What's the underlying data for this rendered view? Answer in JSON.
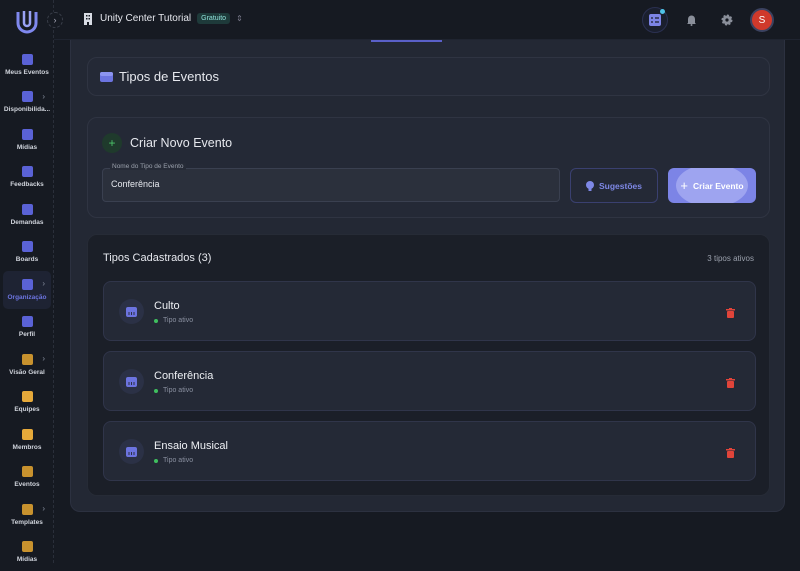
{
  "header": {
    "org_name": "Unity Center Tutorial",
    "plan_badge": "Gratuito",
    "avatar_initial": "S"
  },
  "sidebar": {
    "items": [
      {
        "label": "Meus Eventos",
        "color": "#5a62d6",
        "chevron": false,
        "active": false
      },
      {
        "label": "Disponibilida...",
        "color": "#5a62d6",
        "chevron": true,
        "active": false
      },
      {
        "label": "Mídias",
        "color": "#5a62d6",
        "chevron": false,
        "active": false
      },
      {
        "label": "Feedbacks",
        "color": "#5a62d6",
        "chevron": false,
        "active": false
      },
      {
        "label": "Demandas",
        "color": "#5a62d6",
        "chevron": false,
        "active": false
      },
      {
        "label": "Boards",
        "color": "#5a62d6",
        "chevron": false,
        "active": false
      },
      {
        "label": "Organização",
        "color": "#5a62d6",
        "chevron": true,
        "active": true
      },
      {
        "label": "Perfil",
        "color": "#5a62d6",
        "chevron": false,
        "active": false
      },
      {
        "label": "Visão Geral",
        "color": "#c8922e",
        "chevron": true,
        "active": false
      },
      {
        "label": "Equipes",
        "color": "#e6a93a",
        "chevron": false,
        "active": false
      },
      {
        "label": "Membros",
        "color": "#e6a93a",
        "chevron": false,
        "active": false
      },
      {
        "label": "Eventos",
        "color": "#c8922e",
        "chevron": false,
        "active": false
      },
      {
        "label": "Templates",
        "color": "#c8922e",
        "chevron": true,
        "active": false
      },
      {
        "label": "Mídias",
        "color": "#c8922e",
        "chevron": false,
        "active": false
      }
    ]
  },
  "page": {
    "title": "Tipos de Eventos"
  },
  "create": {
    "title": "Criar Novo Evento",
    "field_label": "Nome do Tipo de Evento",
    "field_value": "Conferência",
    "suggestions_label": "Sugestões",
    "create_label": "Criar Evento"
  },
  "list": {
    "title": "Tipos Cadastrados (3)",
    "count_text": "3 tipos ativos",
    "items": [
      {
        "name": "Culto",
        "status": "Tipo ativo"
      },
      {
        "name": "Conferência",
        "status": "Tipo ativo"
      },
      {
        "name": "Ensaio Musical",
        "status": "Tipo ativo"
      }
    ]
  },
  "colors": {
    "accent": "#7c84e6",
    "danger": "#e0443a",
    "success": "#3fbf5f"
  }
}
